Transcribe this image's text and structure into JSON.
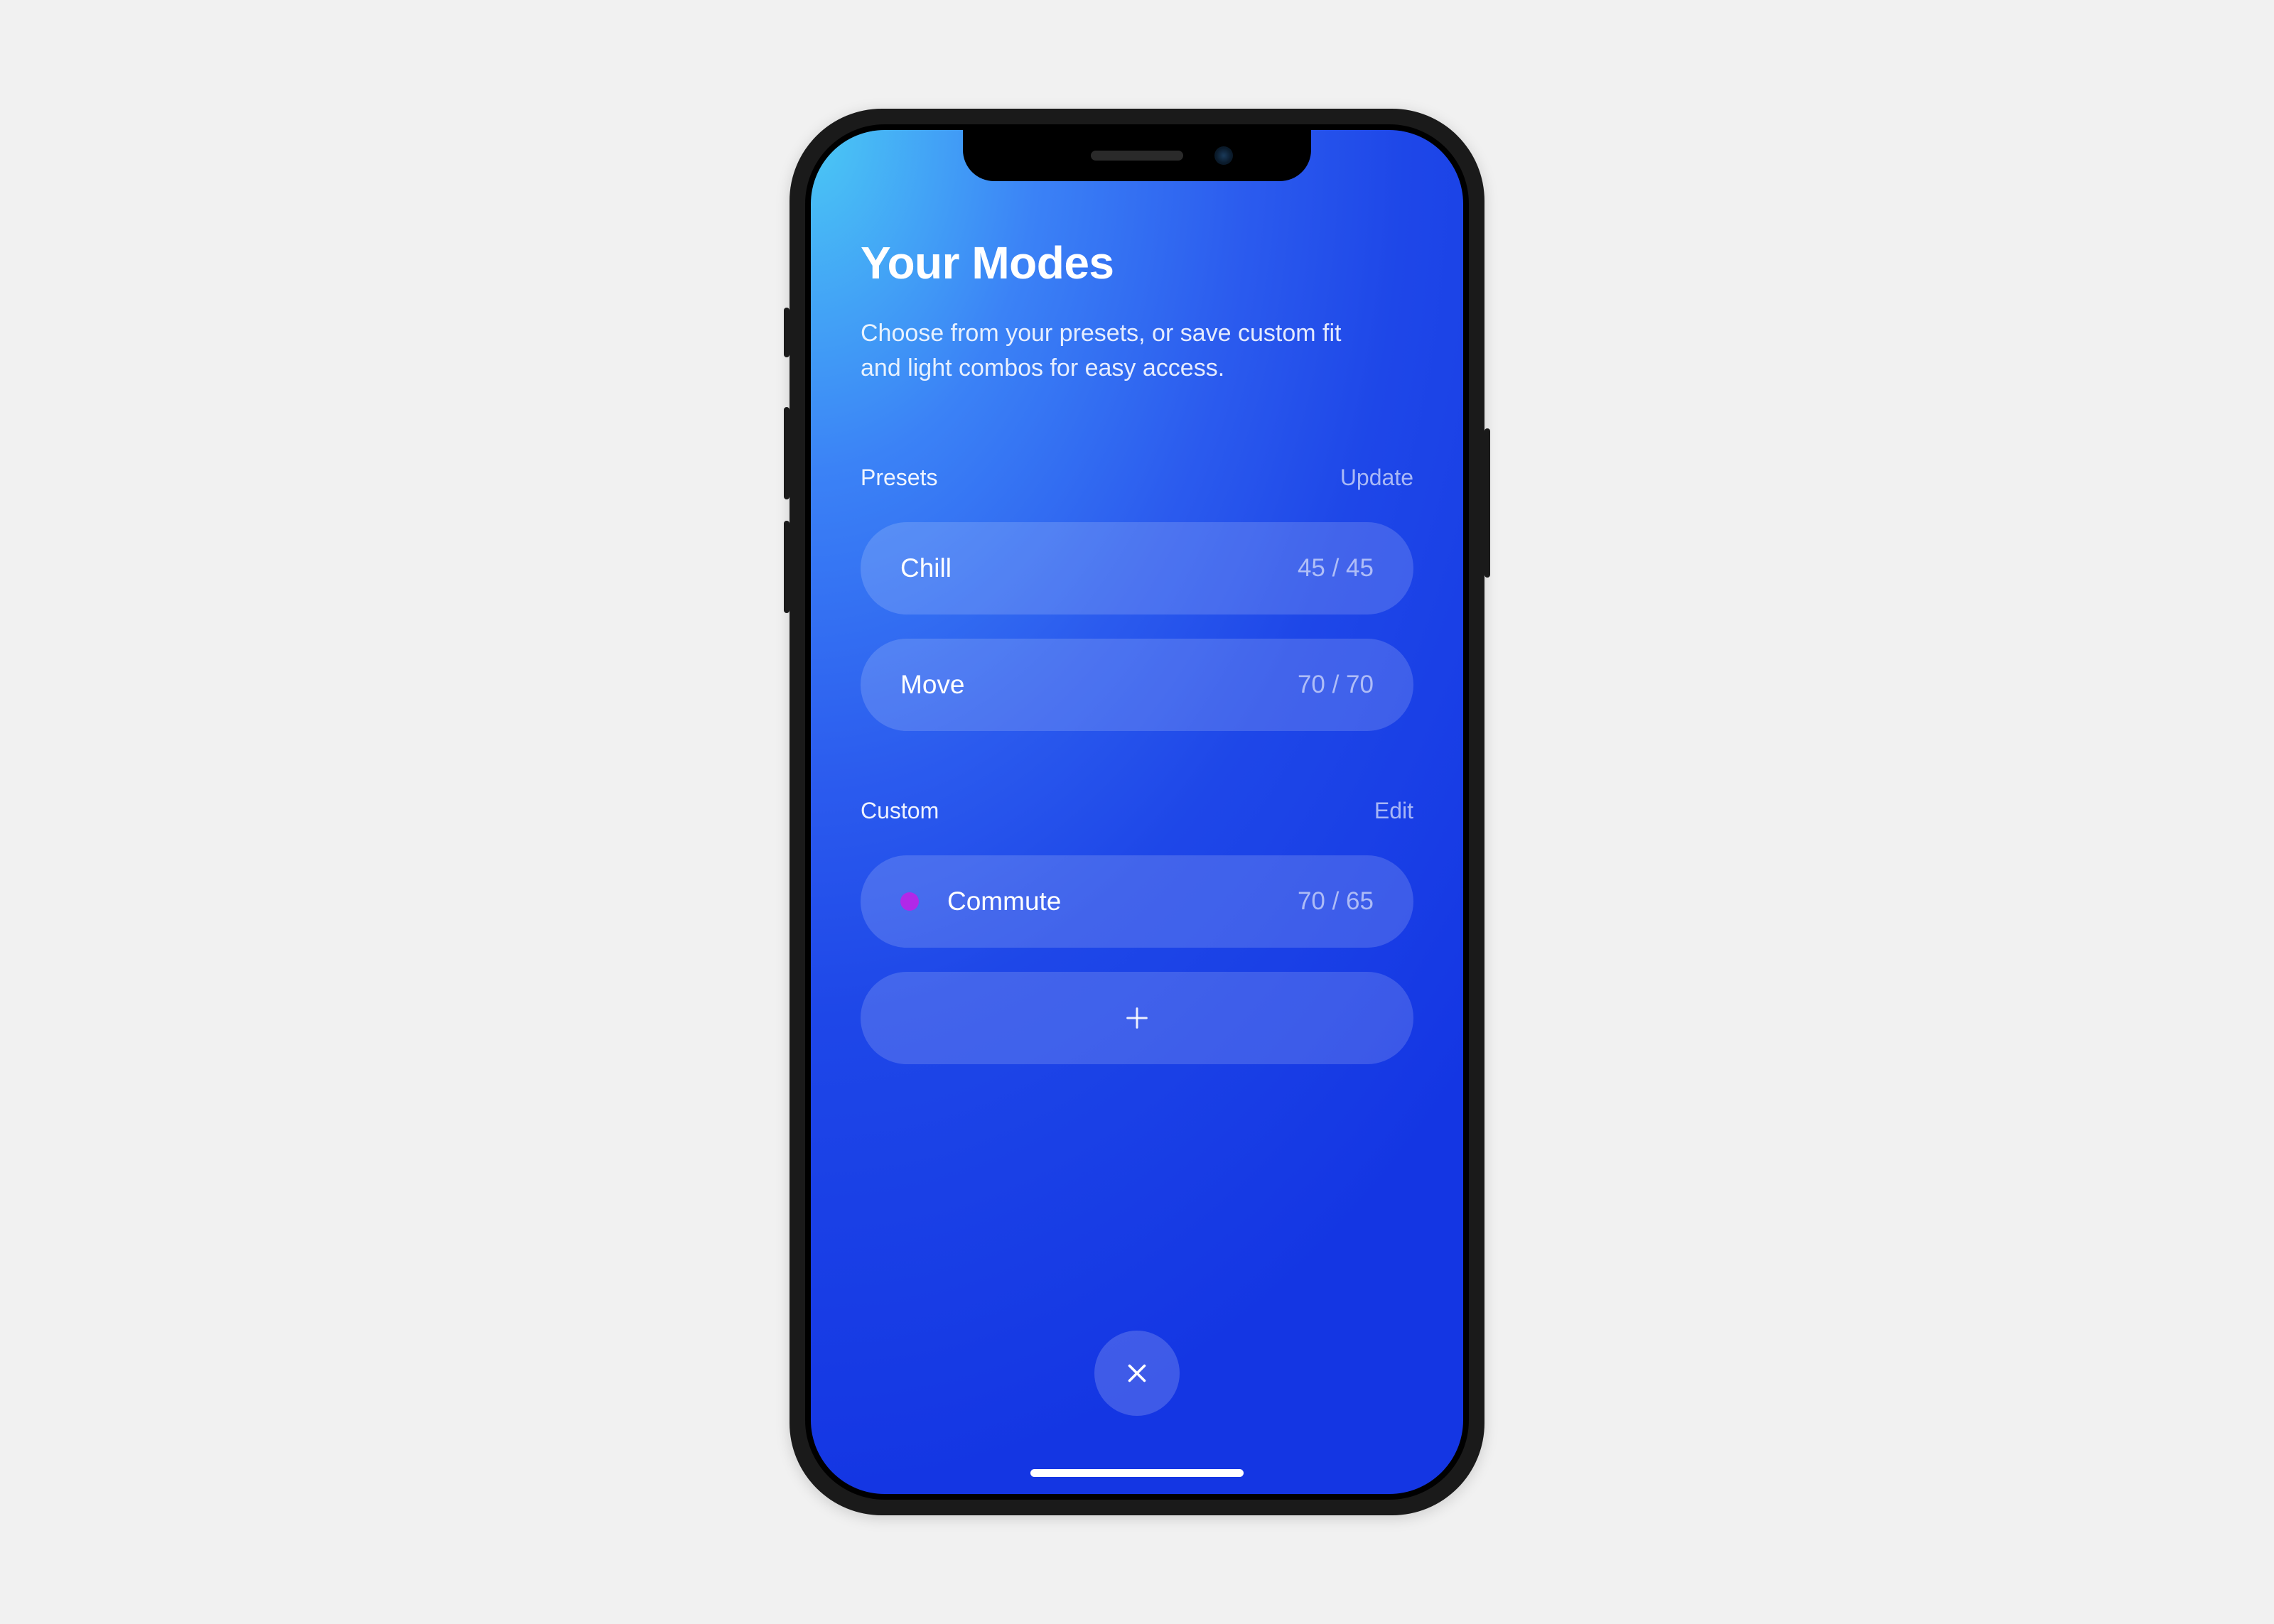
{
  "header": {
    "title": "Your Modes",
    "subtitle": "Choose from your presets, or save custom fit and light combos for easy access."
  },
  "sections": {
    "presets": {
      "label": "Presets",
      "action": "Update",
      "items": [
        {
          "label": "Chill",
          "value": "45 / 45"
        },
        {
          "label": "Move",
          "value": "70 / 70"
        }
      ]
    },
    "custom": {
      "label": "Custom",
      "action": "Edit",
      "items": [
        {
          "label": "Commute",
          "value": "70 / 65",
          "dot_color": "#B128E8"
        }
      ]
    }
  },
  "colors": {
    "accent_dot": "#B128E8",
    "gradient_start": "#4BC9F5",
    "gradient_end": "#1436E3",
    "bg": "#f1f1f1"
  }
}
